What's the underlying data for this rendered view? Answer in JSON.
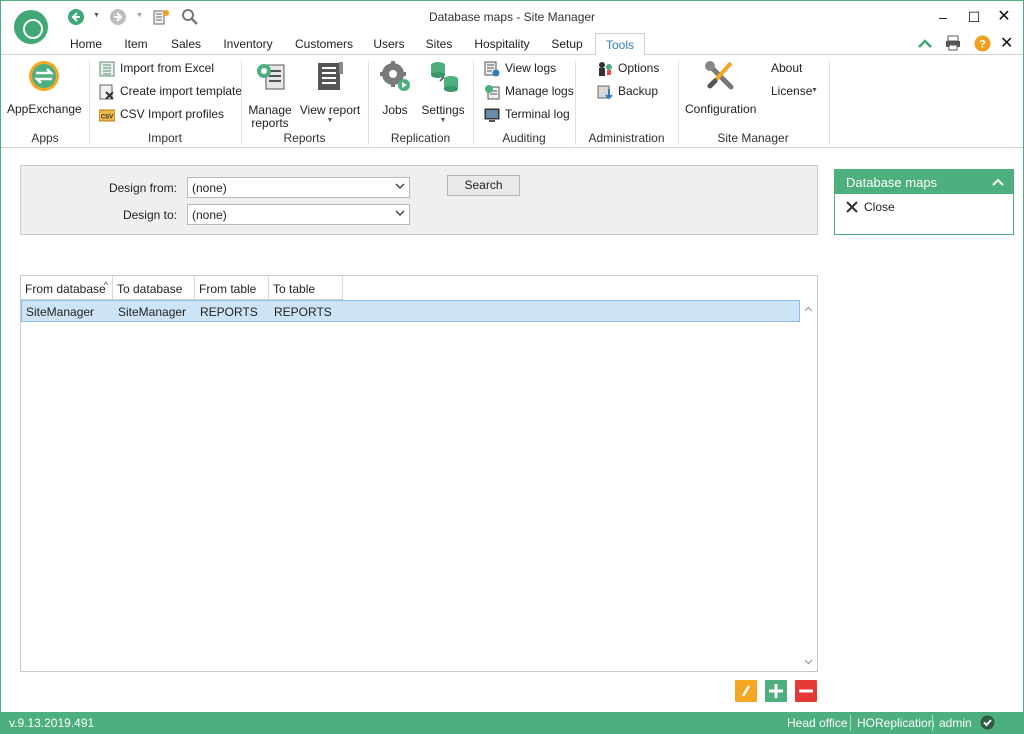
{
  "window": {
    "title": "Database maps - Site Manager",
    "accent": "#4caf7d"
  },
  "quick_access": {
    "back_icon": "back-arrow-icon",
    "forward_icon": "forward-arrow-icon",
    "notes_icon": "notes-icon",
    "search_icon": "search-icon"
  },
  "tabs": [
    {
      "label": "Home"
    },
    {
      "label": "Item"
    },
    {
      "label": "Sales"
    },
    {
      "label": "Inventory"
    },
    {
      "label": "Customers"
    },
    {
      "label": "Users"
    },
    {
      "label": "Sites"
    },
    {
      "label": "Hospitality"
    },
    {
      "label": "Setup"
    },
    {
      "label": "Tools"
    }
  ],
  "active_tab": "Tools",
  "ribbon": {
    "apps": {
      "label": "Apps",
      "appexchange": "AppExchange"
    },
    "import": {
      "label": "Import",
      "import_excel": "Import from Excel",
      "create_template": "Create import template",
      "csv_profiles": "CSV Import profiles"
    },
    "reports": {
      "label": "Reports",
      "manage_line1": "Manage",
      "manage_line2": "reports",
      "view_report": "View report"
    },
    "replication": {
      "label": "Replication",
      "jobs": "Jobs",
      "settings": "Settings"
    },
    "auditing": {
      "label": "Auditing",
      "view_logs": "View logs",
      "manage_logs": "Manage logs",
      "terminal_log": "Terminal log"
    },
    "administration": {
      "label": "Administration",
      "options": "Options",
      "backup": "Backup"
    },
    "site_manager": {
      "label": "Site Manager",
      "configuration": "Configuration",
      "about": "About",
      "license": "License"
    }
  },
  "filter": {
    "design_from_label": "Design from:",
    "design_from_value": "(none)",
    "design_to_label": "Design to:",
    "design_to_value": "(none)",
    "search_label": "Search"
  },
  "grid": {
    "columns": [
      "From database",
      "To database",
      "From table",
      "To table"
    ],
    "rows": [
      [
        "SiteManager",
        "SiteManager",
        "REPORTS",
        "REPORTS"
      ]
    ]
  },
  "side_panel": {
    "title": "Database maps",
    "close_label": "Close"
  },
  "status_bar": {
    "version": "v.9.13.2019.491",
    "location": "Head office",
    "replication": "HOReplication",
    "user": "admin"
  }
}
